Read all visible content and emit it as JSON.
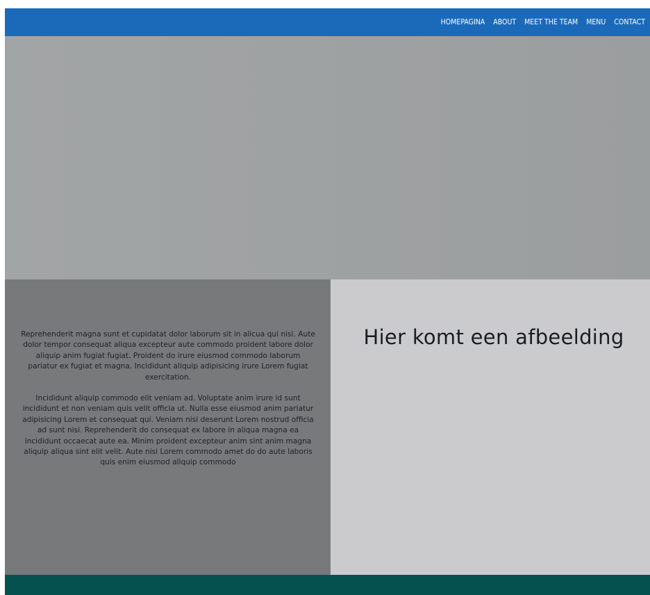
{
  "nav": {
    "items": [
      {
        "label": "HOMEPAGINA"
      },
      {
        "label": "ABOUT"
      },
      {
        "label": "MEET THE TEAM"
      },
      {
        "label": "MENU"
      },
      {
        "label": "CONTACT"
      }
    ]
  },
  "main": {
    "paragraph_1": "Reprehenderit magna sunt et cupidatat dolor laborum sit in alicua qui nisi. Aute dolor tempor consequat aliqua excepteur aute commodo proident labore dolor aliquip anim fugiat fugiat. Proident do irure eiusmod commodo laborum pariatur ex fugiat et magna. Incididunt aliquip adipisicing irure Lorem fugiat exercitation.",
    "paragraph_2": "Incididunt aliquip commodo elit veniam ad. Voluptate anim irure id sunt incididunt et non veniam quis velit officia ut. Nulla esse eiusmod anim pariatur adipisicing Lorem et consequat qui. Veniam nisi deserunt Lorem nostrud officia ad sunt nisi. Reprehenderit do consequat ex labore in aliqua magna ea incididunt occaecat aute ea. Minim proident excepteur anim sint anim magna aliquip aliqua sint elit velit. Aute nisi Lorem commodo amet do do aute laboris quis enim eiusmod aliquip commodo",
    "image_placeholder": "Hier komt een afbeelding"
  },
  "colors": {
    "navbar": "#1b6aba",
    "hero": "#a0a3a4",
    "text_panel": "#77797b",
    "image_panel": "#cbcbcd",
    "footer": "#045150"
  }
}
